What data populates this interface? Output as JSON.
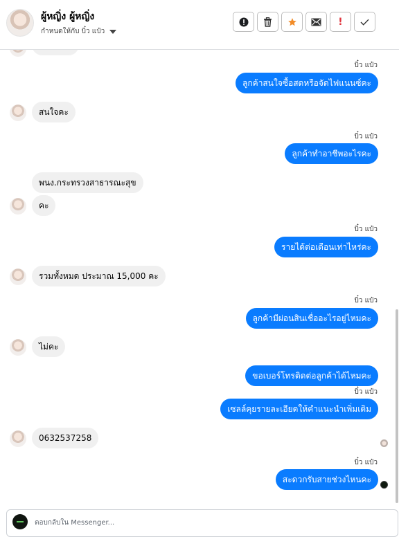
{
  "header": {
    "name": "ผู้หญิ่ง ผู้หญิ่ง",
    "assigned": "กำหนดให้กับ บิ๋ว แป๋ว",
    "actions": [
      {
        "name": "report-icon"
      },
      {
        "name": "trash-icon"
      },
      {
        "name": "star-icon",
        "color": "#f28c28"
      },
      {
        "name": "mail-icon"
      },
      {
        "name": "spam-icon",
        "color": "#e0343d"
      },
      {
        "name": "check-icon"
      }
    ]
  },
  "messages": {
    "s1": "บิ๋ว แป๋ว",
    "o1": "ลูกค้าสนใจซื้อสดหรือจัดไฟแนนซ์คะ",
    "i1": "สนใจคะ",
    "s2": "บิ๋ว แป๋ว",
    "o2": "ลูกค้าทำอาชีพอะไรคะ",
    "i2": "พนง.กระทรวงสาธารณะสุข",
    "i3": "คะ",
    "s3": "บิ๋ว แป๋ว",
    "o3": "รายได้ต่อเดือนเท่าไหร่คะ",
    "i4": "รวมทั้งหมด ประมาณ 15,000 คะ",
    "s4": "บิ๋ว แป๋ว",
    "o4": "ลูกค้ามีผ่อนสินเชื่ออะไรอยู่ไหมคะ",
    "i5": "ไม่คะ",
    "o5": "ขอเบอร์โทรติดต่อลูกค้าได้ไหมคะ",
    "s5": "บิ๋ว แป๋ว",
    "o6": "เซลล์คุยรายละเอียดให้คำแนะนำเพิ่มเติม",
    "i6": "0632537258",
    "s6": "บิ๋ว แป๋ว",
    "o7": "สะดวกรับสายช่วงไหนคะ"
  },
  "composer": {
    "placeholder": "ตอบกลับใน Messenger..."
  },
  "colors": {
    "outgoing": "#0a7cff",
    "incoming": "#f0f0f0"
  }
}
